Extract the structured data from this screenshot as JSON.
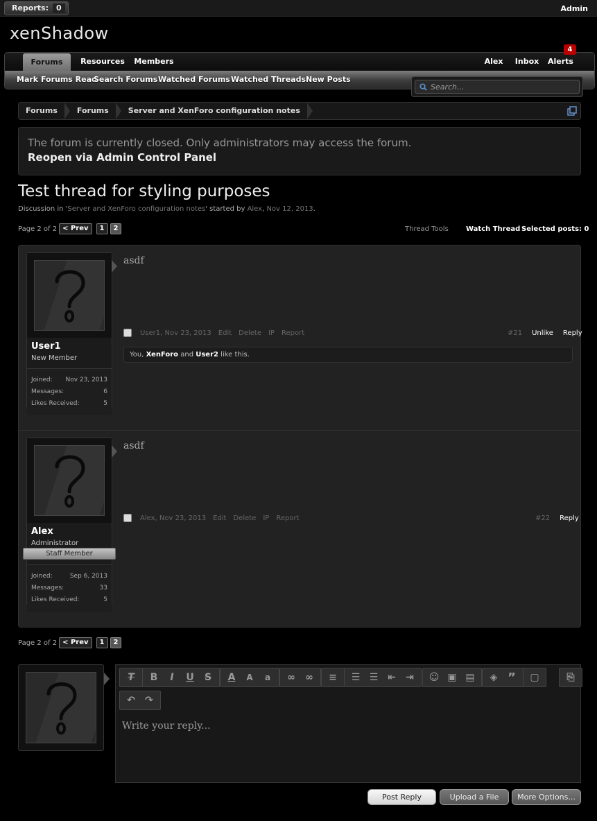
{
  "topbar": {
    "reports_label": "Reports:",
    "reports_count": "0",
    "admin": "Admin"
  },
  "logo": {
    "part1": "xen",
    "part2": "Shadow"
  },
  "nav": {
    "tabs": [
      "Forums",
      "Resources",
      "Members"
    ],
    "right": [
      "Alex",
      "Inbox",
      "Alerts"
    ],
    "alerts_count": "4",
    "sub": [
      "Mark Forums Read",
      "Search Forums",
      "Watched Forums",
      "Watched Threads",
      "New Posts"
    ]
  },
  "search": {
    "placeholder": "Search..."
  },
  "breadcrumb": [
    "Forums",
    "Forums",
    "Server and XenForo configuration notes"
  ],
  "notice": {
    "message": "The forum is currently closed. Only administrators may access the forum.",
    "link": "Reopen via Admin Control Panel"
  },
  "thread": {
    "title": "Test thread for styling purposes",
    "desc_prefix": "Discussion in '",
    "desc_forum": "Server and XenForo configuration notes",
    "desc_mid": "' started by ",
    "desc_author": "Alex",
    "desc_sep": ", ",
    "desc_date": "Nov 12, 2013",
    "desc_end": "."
  },
  "pagenav": {
    "label": "Page 2 of 2",
    "prev": "< Prev",
    "p1": "1",
    "p2": "2"
  },
  "tools": {
    "thread_tools": "Thread Tools",
    "watch": "Watch Thread",
    "selected": "Selected posts: 0"
  },
  "posts": [
    {
      "username": "User1",
      "usertitle": "New Member",
      "stats": [
        [
          "Joined:",
          "Nov 23, 2013"
        ],
        [
          "Messages:",
          "6"
        ],
        [
          "Likes Received:",
          "5"
        ]
      ],
      "message": "asdf",
      "meta": {
        "author": "User1",
        "date": "Nov 23, 2013",
        "actions": [
          "Edit",
          "Delete",
          "IP",
          "Report"
        ]
      },
      "number": "#21",
      "right_actions": [
        "Unlike",
        "Reply"
      ],
      "likes": {
        "u1": "You",
        "sep1": ", ",
        "u2": "XenForo",
        "sep2": " and ",
        "u3": "User2",
        "end": " like this."
      }
    },
    {
      "username": "Alex",
      "usertitle": "Administrator",
      "banner": "Staff Member",
      "stats": [
        [
          "Joined:",
          "Sep 6, 2013"
        ],
        [
          "Messages:",
          "33"
        ],
        [
          "Likes Received:",
          "5"
        ]
      ],
      "message": "asdf",
      "meta": {
        "author": "Alex",
        "date": "Nov 23, 2013",
        "actions": [
          "Edit",
          "Delete",
          "IP",
          "Report"
        ]
      },
      "number": "#22",
      "right_actions": [
        "Reply"
      ]
    }
  ],
  "editor": {
    "placeholder": "Write your reply..."
  },
  "buttons": {
    "post_reply": "Post Reply",
    "upload": "Upload a File",
    "more": "More Options..."
  }
}
